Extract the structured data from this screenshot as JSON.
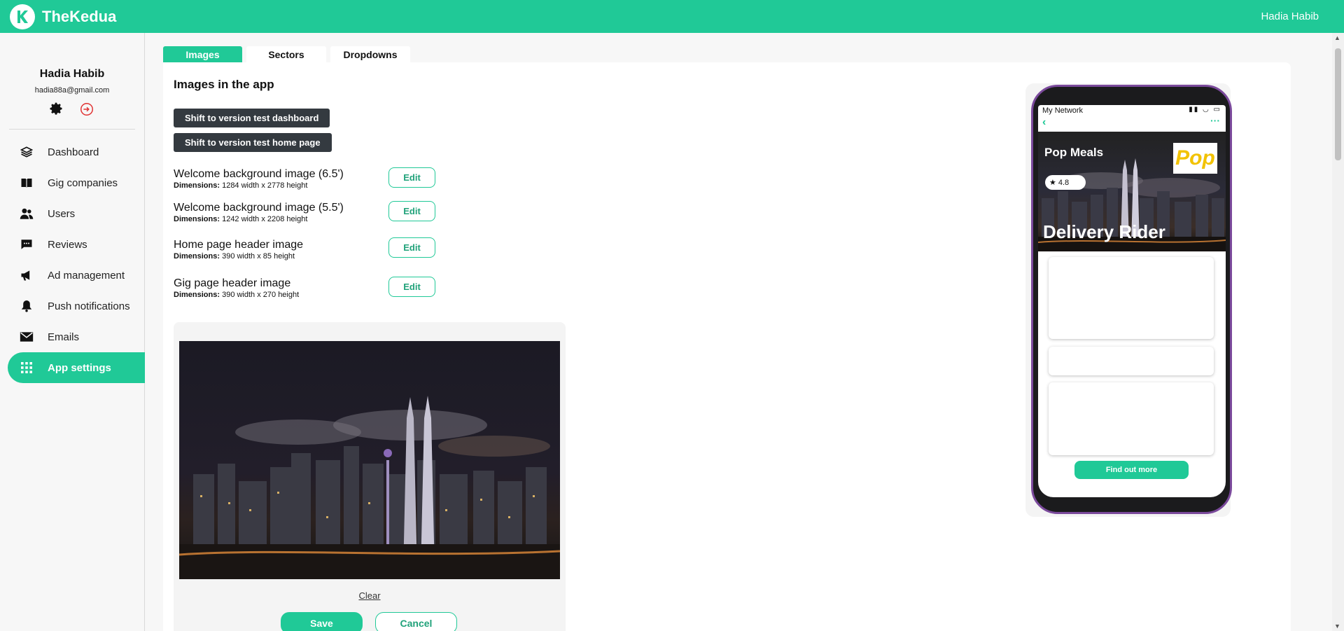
{
  "app": {
    "brand": "TheKedua",
    "top_user": "Hadia Habib",
    "accent": "#20c997"
  },
  "sidebar": {
    "name": "Hadia Habib",
    "email": "hadia88a@gmail.com",
    "items": [
      {
        "label": "Dashboard",
        "icon": "layers-icon"
      },
      {
        "label": "Gig companies",
        "icon": "book-icon"
      },
      {
        "label": "Users",
        "icon": "users-icon"
      },
      {
        "label": "Reviews",
        "icon": "chat-icon"
      },
      {
        "label": "Ad management",
        "icon": "megaphone-icon"
      },
      {
        "label": "Push notifications",
        "icon": "bell-icon"
      },
      {
        "label": "Emails",
        "icon": "mail-icon"
      },
      {
        "label": "App settings",
        "icon": "grid-icon",
        "active": true
      }
    ]
  },
  "tabs": [
    "Images",
    "Sectors",
    "Dropdowns"
  ],
  "main": {
    "title": "Images in the app",
    "btn_dashboard": "Shift to version test dashboard",
    "btn_home": "Shift to version test home page",
    "dim_label": "Dimensions:",
    "edit_label": "Edit",
    "images": [
      {
        "label": "Welcome background image (6.5')",
        "dims": "1284 width x 2778 height"
      },
      {
        "label": "Welcome background image (5.5')",
        "dims": "1242 width x  2208 height"
      },
      {
        "label": "Home page header image",
        "dims": "390 width x 85 height"
      },
      {
        "label": "Gig page header image",
        "dims": "390 width x 270 height"
      }
    ],
    "clear": "Clear",
    "save": "Save",
    "cancel": "Cancel"
  },
  "phone": {
    "carrier": "My Network",
    "company": "Pop Meals",
    "logo_text": "Pop",
    "rating": "4.8",
    "title": "Delivery Rider",
    "cta": "Find out more"
  }
}
